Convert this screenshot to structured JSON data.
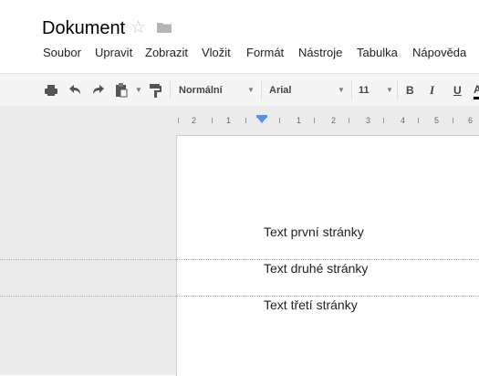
{
  "document": {
    "title": "Dokument"
  },
  "menu": [
    "Soubor",
    "Upravit",
    "Zobrazit",
    "Vložit",
    "Formát",
    "Nástroje",
    "Tabulka",
    "Nápověda"
  ],
  "toolbar": {
    "style": "Normální",
    "font": "Arial",
    "size": "11",
    "bold": "B",
    "italic": "I",
    "underline": "U"
  },
  "ruler": {
    "ticks": [
      "2",
      "1",
      "1",
      "2",
      "3",
      "4",
      "5",
      "6"
    ]
  },
  "pages": [
    {
      "text": "Text první stránky"
    },
    {
      "text": "Text druhé stránky"
    },
    {
      "text": "Text třetí stránky"
    }
  ]
}
